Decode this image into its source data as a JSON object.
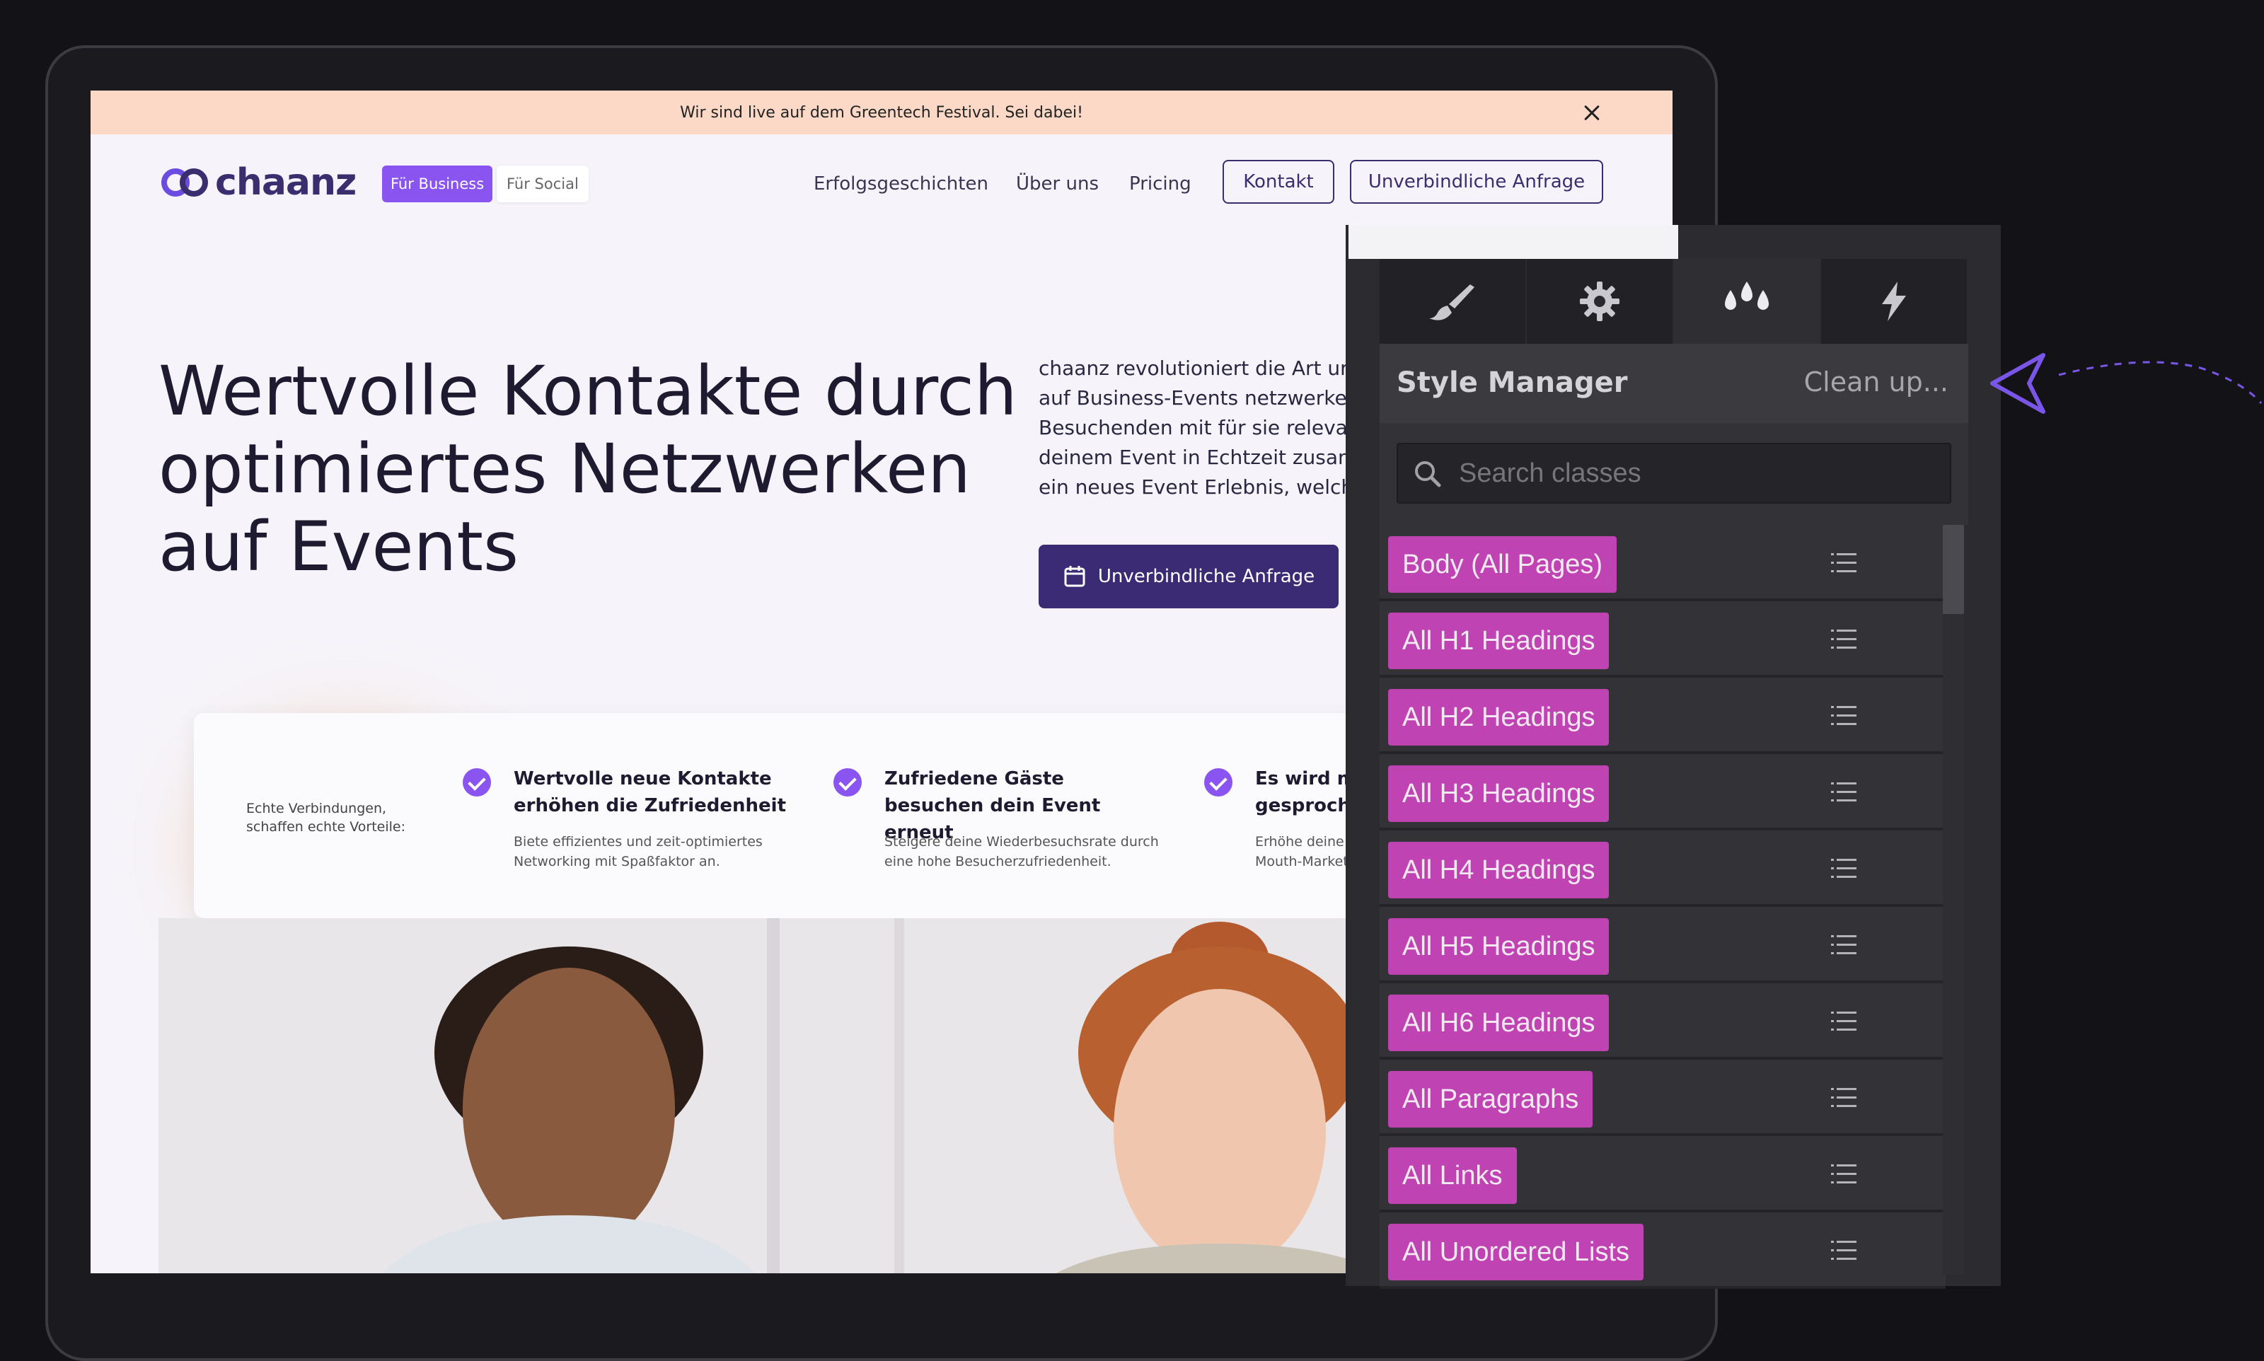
{
  "site": {
    "announcement": "Wir sind live auf dem Greentech Festival. Sei dabei!",
    "logo_text": "chaanz",
    "segment_business": "Für Business",
    "segment_social": "Für Social",
    "nav": [
      "Erfolgsgeschichten",
      "Über uns",
      "Pricing"
    ],
    "btn_kontakt": "Kontakt",
    "btn_anfrage": "Unverbindliche Anfrage",
    "hero_title": "Wertvolle Kontakte durch optimiertes Netzwerken auf Events",
    "hero_description": "chaanz revolutioniert die Art ur\nauf Business-Events netzwerke\nBesuchenden mit für sie releva\ndeinem Event in Echtzeit zusam\nein neues Event Erlebnis, welch",
    "hero_button": "Unverbindliche Anfrage",
    "features_intro": "Echte Verbindungen,\nschaffen echte Vorteile:",
    "features": [
      {
        "title": "Wertvolle neue Kontakte erhöhen die Zufriedenheit",
        "text": "Biete effizientes und zeit-optimiertes Networking mit Spaßfaktor an."
      },
      {
        "title": "Zufriedene Gäste besuchen dein Event erneut",
        "text": "Steigere deine Wiederbesuchsrate durch eine hohe Besucherzufriedenheit."
      },
      {
        "title": "Es wird mel gesprocher",
        "text": "Erhöhe deine Re Mouth-Marketir"
      }
    ]
  },
  "style_manager": {
    "title": "Style Manager",
    "cleanup": "Clean up...",
    "search_placeholder": "Search classes",
    "classes": [
      "Body (All Pages)",
      "All H1 Headings",
      "All H2 Headings",
      "All H3 Headings",
      "All H4 Headings",
      "All H5 Headings",
      "All H6 Headings",
      "All Paragraphs",
      "All Links",
      "All Unordered Lists"
    ],
    "tabs": [
      "brush-icon",
      "gear-icon",
      "drops-icon",
      "lightning-icon"
    ],
    "chip_color": "#c043b3"
  },
  "colors": {
    "brand_purple": "#3b2a74",
    "accent_violet": "#8a54f0",
    "announcement_bg": "#fcd9c6"
  }
}
